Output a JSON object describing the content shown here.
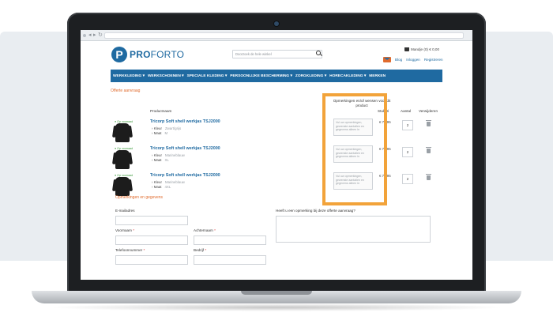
{
  "browser": {
    "nav_back": "◂",
    "nav_forward": "▸",
    "nav_reload": "↻"
  },
  "header": {
    "logo_letter": "P",
    "logo_bold": "PRO",
    "logo_thin": "FORTO",
    "search_placeholder": "Doorzoek de hele winkel",
    "cart_text": "Mandje (0) € 0,00",
    "links": [
      "Blog",
      "Inloggen",
      "Registreren"
    ]
  },
  "nav": {
    "items": [
      "WERKKLEDING",
      "WERKSCHOENEN",
      "SPECIALE KLEDING",
      "PERSOONLIJKE BESCHERMING",
      "ZORGKLEDING",
      "HORECAKLEDING",
      "MERKEN"
    ]
  },
  "quote": {
    "title": "Offerte aanvraag",
    "col_product": "Productnaam",
    "col_notes": "Opmerkingen en/of wensen voor dit product",
    "col_price": "Stukprijs",
    "col_qty": "Aantal",
    "col_remove": "Verwijderen",
    "stock_label": "● Op voorraad",
    "color_label": "Kleur",
    "size_label": "Maat",
    "note_placeholder": "Vul uw opmerkingen, gewenste aantallen en gegevens alleen in",
    "items": [
      {
        "name": "Tricorp Soft shell werkjas TSJ2000",
        "color": "Zwart/grijs",
        "size": "M",
        "price": "€ 79,95",
        "qty": "2"
      },
      {
        "name": "Tricorp Soft shell werkjas TSJ2000",
        "color": "Marineblauw",
        "size": "XL",
        "price": "€ 79,95",
        "qty": "2"
      },
      {
        "name": "Tricorp Soft shell werkjas TSJ2000",
        "color": "Marineblauw",
        "size": "4XL",
        "price": "€ 79,95",
        "qty": "2"
      }
    ]
  },
  "form": {
    "title": "Opmerkingen en gegevens",
    "email_label": "E-mailadres",
    "first_name_label": "Voornaam",
    "last_name_label": "Achternaam",
    "phone_label": "Telefoonnummer",
    "company_label": "Bedrijf",
    "question_label": "Heeft u een opmerking bij deze offerte aanvraag?",
    "required_mark": "*"
  },
  "colors": {
    "brand_blue": "#1f6aa1",
    "accent_orange": "#e06b2d",
    "highlight": "#f2a33a"
  }
}
